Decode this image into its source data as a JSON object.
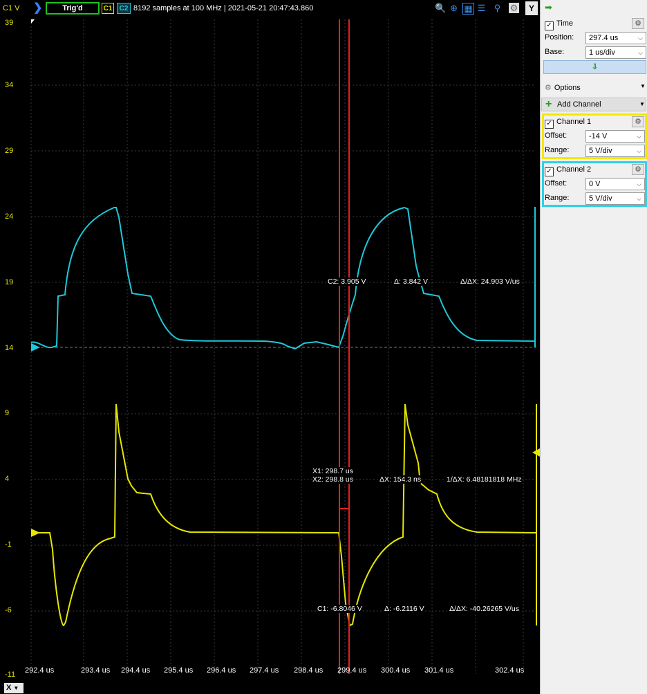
{
  "topbar": {
    "channel_label": "C1 V",
    "status": "Trig'd",
    "c1": "C1",
    "c2": "C2",
    "info": "8192 samples at 100 MHz | 2021-05-21 20:47:43.860",
    "y_button": "Y"
  },
  "y_axis_labels": [
    "39",
    "34",
    "29",
    "24",
    "19",
    "14",
    "9",
    "4",
    "-1",
    "-6",
    "-11"
  ],
  "x_axis_labels": [
    "292.4 us",
    "293.4 us",
    "294.4 us",
    "295.4 us",
    "296.4 us",
    "297.4 us",
    "298.4 us",
    "299.4 us",
    "300.4 us",
    "301.4 us",
    "302.4 us"
  ],
  "x_button": "X",
  "annotations": {
    "c2_value": "C2: 3.905 V",
    "c2_delta": "Δ: 3.842 V",
    "c2_slope": "Δ/ΔX: 24.903 V/us",
    "x1": "X1: 298.7 us",
    "x2": "X2: 298.8 us",
    "dx": "ΔX: 154.3 ns",
    "inv_dx": "1/ΔX: 6.48181818 MHz",
    "c1_value": "C1: -6.8046 V",
    "c1_delta": "Δ: -6.2116 V",
    "c1_slope": "Δ/ΔX: -40.26265 V/us"
  },
  "panel": {
    "arrow": "➡",
    "time": {
      "label": "Time",
      "position_label": "Position:",
      "position_value": "297.4 us",
      "base_label": "Base:",
      "base_value": "1 us/div"
    },
    "options_label": "Options",
    "add_channel_label": "Add Channel",
    "channel1": {
      "label": "Channel 1",
      "offset_label": "Offset:",
      "offset_value": "-14 V",
      "range_label": "Range:",
      "range_value": "5 V/div",
      "color": "#f5e800"
    },
    "channel2": {
      "label": "Channel 2",
      "offset_label": "Offset:",
      "offset_value": "0 V",
      "range_label": "Range:",
      "range_value": "5 V/div",
      "color": "#2cd2e6"
    }
  },
  "colors": {
    "ch1": "#e6e600",
    "ch2": "#1ec8d8",
    "cursor": "#e02020",
    "grid": "#3a3a3a"
  }
}
